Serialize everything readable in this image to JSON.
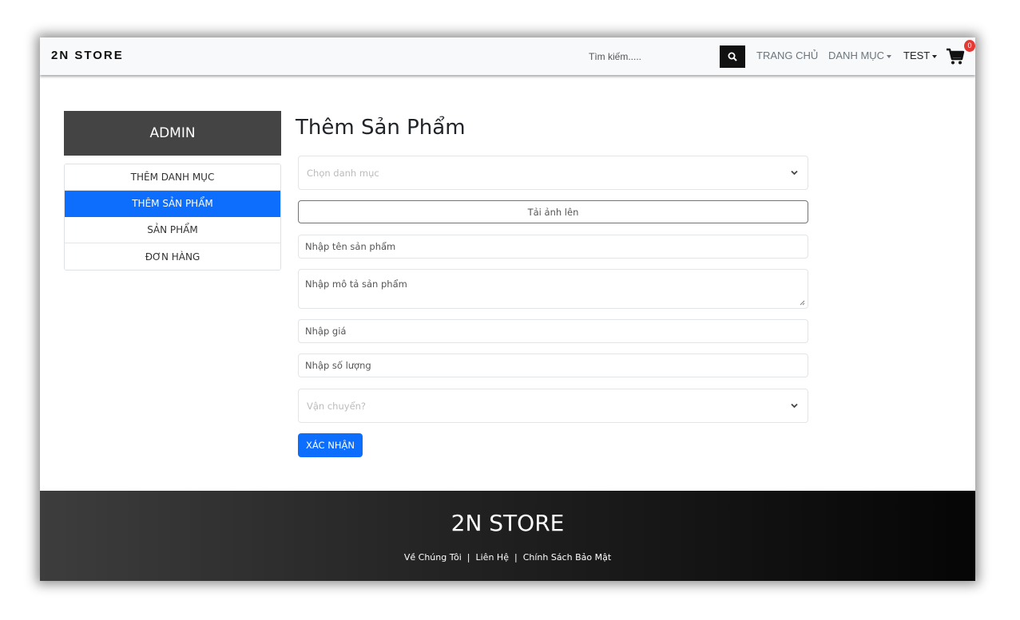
{
  "navbar": {
    "brand": "2N STORE",
    "search_placeholder": "Tìm kiếm.....",
    "links": {
      "home": "TRANG CHỦ",
      "category": "DANH MỤC",
      "user": "TEST"
    },
    "cart_count": "0"
  },
  "sidebar": {
    "header": "ADMIN",
    "items": [
      {
        "label": "THÊM DANH MỤC"
      },
      {
        "label": "THÊM SẢN PHẨM"
      },
      {
        "label": "SẢN PHẨM"
      },
      {
        "label": "ĐƠN HÀNG"
      }
    ]
  },
  "form": {
    "title": "Thêm Sản Phẩm",
    "category_select": "Chọn danh mục",
    "upload_label": "Tải ảnh lên",
    "name_placeholder": "Nhập tên sản phẩm",
    "description_placeholder": "Nhập mô tả sản phẩm",
    "price_placeholder": "Nhập giá",
    "quantity_placeholder": "Nhập số lượng",
    "shipping_select": "Vận chuyển?",
    "submit_label": "XÁC NHẬN"
  },
  "footer": {
    "brand": "2N STORE",
    "links": [
      "Về Chúng Tôi",
      "Liên Hệ",
      "Chính Sách Bảo Mật"
    ],
    "separator": "|"
  },
  "colors": {
    "primary": "#0d6efd",
    "admin_header": "#444444",
    "badge": "#e53935"
  }
}
